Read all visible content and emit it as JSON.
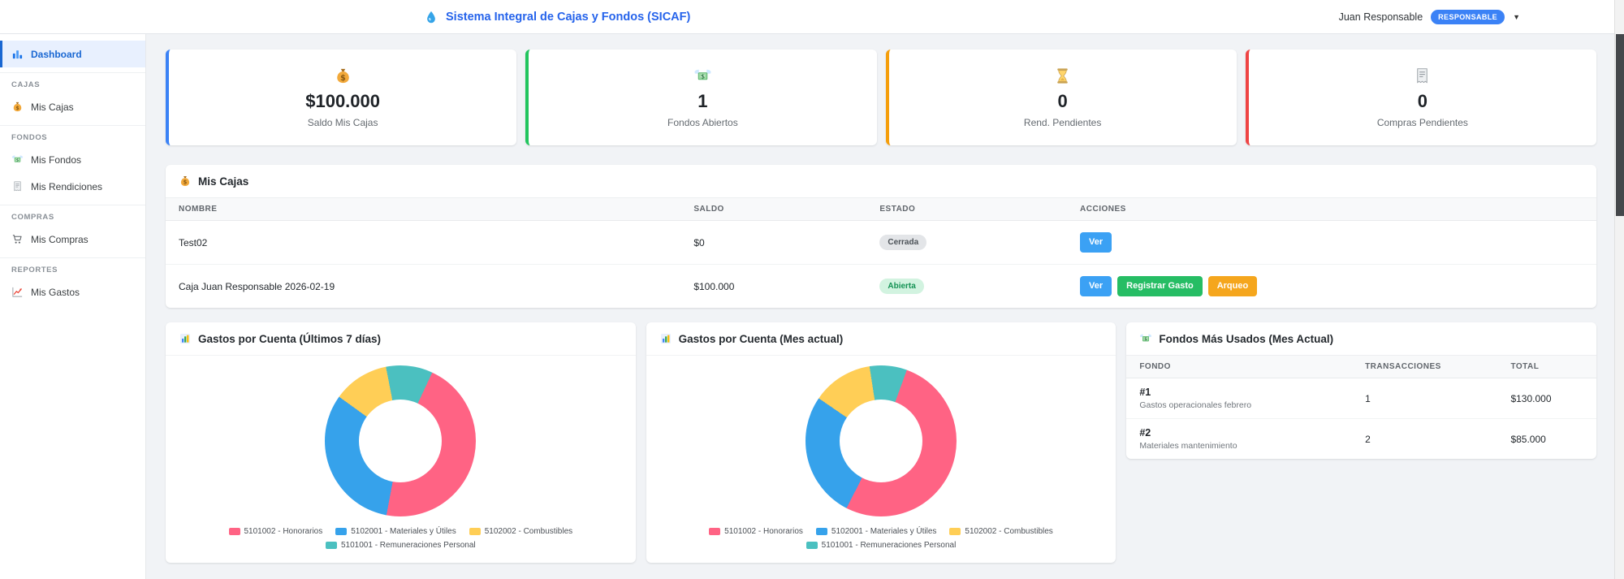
{
  "header": {
    "brand_icon": "droplet",
    "title": "Sistema Integral de Cajas y Fondos (SICAF)",
    "user": {
      "name": "Juan Responsable",
      "role_badge": "RESPONSABLE",
      "caret": "▼"
    }
  },
  "sidebar": {
    "items": [
      {
        "type": "link",
        "label": "Dashboard",
        "icon": "dashboard",
        "active": true
      },
      {
        "type": "section",
        "label": "CAJAS"
      },
      {
        "type": "link",
        "label": "Mis Cajas",
        "icon": "money-bag"
      },
      {
        "type": "section",
        "label": "FONDOS"
      },
      {
        "type": "link",
        "label": "Mis Fondos",
        "icon": "money-wings"
      },
      {
        "type": "link",
        "label": "Mis Rendiciones",
        "icon": "receipt"
      },
      {
        "type": "section",
        "label": "COMPRAS"
      },
      {
        "type": "link",
        "label": "Mis Compras",
        "icon": "cart"
      },
      {
        "type": "section",
        "label": "REPORTES"
      },
      {
        "type": "link",
        "label": "Mis Gastos",
        "icon": "chart-up"
      }
    ]
  },
  "stats": [
    {
      "icon": "money-bag",
      "value": "$100.000",
      "label": "Saldo Mis Cajas",
      "accent": "#3b82f6"
    },
    {
      "icon": "money-wings",
      "value": "1",
      "label": "Fondos Abiertos",
      "accent": "#22c55e"
    },
    {
      "icon": "hourglass",
      "value": "0",
      "label": "Rend. Pendientes",
      "accent": "#f59e0b"
    },
    {
      "icon": "receipt",
      "value": "0",
      "label": "Compras Pendientes",
      "accent": "#ef4444"
    }
  ],
  "mis_cajas": {
    "icon": "money-bag",
    "title": "Mis Cajas",
    "columns": [
      "NOMBRE",
      "SALDO",
      "ESTADO",
      "ACCIONES"
    ],
    "rows": [
      {
        "nombre": "Test02",
        "saldo": "$0",
        "estado": {
          "text": "Cerrada",
          "style": "secondary"
        },
        "acciones": [
          {
            "label": "Ver",
            "style": "info"
          }
        ]
      },
      {
        "nombre": "Caja Juan Responsable 2026-02-19",
        "saldo": "$100.000",
        "estado": {
          "text": "Abierta",
          "style": "success"
        },
        "acciones": [
          {
            "label": "Ver",
            "style": "info"
          },
          {
            "label": "Registrar Gasto",
            "style": "success"
          },
          {
            "label": "Arqueo",
            "style": "warning"
          }
        ]
      }
    ]
  },
  "chart_data": [
    {
      "type": "pie",
      "variant": "donut",
      "icon": "bar-chart",
      "title": "Gastos por Cuenta (Últimos 7 días)",
      "labels": [
        "5101002 - Honorarios",
        "5102001 - Materiales y Útiles",
        "5102002 - Combustibles",
        "5101001 - Remuneraciones Personal"
      ],
      "values": [
        46,
        32,
        12,
        10
      ],
      "colors": [
        "#ff6384",
        "#36a2eb",
        "#ffce56",
        "#4bc0c0"
      ],
      "rotation_deg": 25,
      "legend_position": "bottom"
    },
    {
      "type": "pie",
      "variant": "donut",
      "icon": "bar-chart",
      "title": "Gastos por Cuenta (Mes actual)",
      "labels": [
        "5101002 - Honorarios",
        "5102001 - Materiales y Útiles",
        "5102002 - Combustibles",
        "5101001 - Remuneraciones Personal"
      ],
      "values": [
        52,
        27,
        13,
        8
      ],
      "colors": [
        "#ff6384",
        "#36a2eb",
        "#ffce56",
        "#4bc0c0"
      ],
      "rotation_deg": 20,
      "legend_position": "bottom"
    }
  ],
  "fondos": {
    "icon": "money-wings",
    "title": "Fondos Más Usados (Mes Actual)",
    "columns": [
      "FONDO",
      "TRANSACCIONES",
      "TOTAL"
    ],
    "rows": [
      {
        "rank": "#1",
        "desc": "Gastos operacionales febrero",
        "transacciones": "1",
        "total": "$130.000"
      },
      {
        "rank": "#2",
        "desc": "Materiales mantenimiento",
        "transacciones": "2",
        "total": "$85.000"
      }
    ]
  },
  "colors": {
    "brand_blue": "#2563eb",
    "active_nav": "#1967d2",
    "role_badge_bg": "#3b82f6",
    "btn_info": "#3ba1f4",
    "btn_success": "#26bd64",
    "btn_warning": "#f5a61d",
    "badge_closed_bg": "#e3e5e8",
    "badge_open_bg": "#d2f3e0"
  }
}
